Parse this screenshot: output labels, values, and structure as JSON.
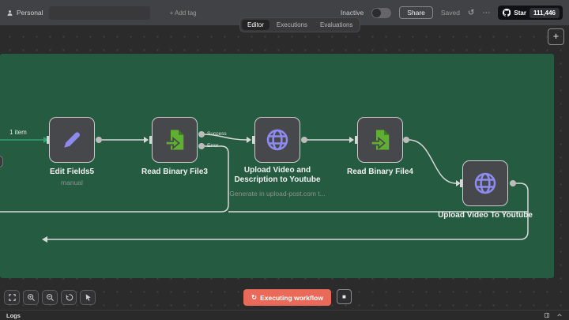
{
  "header": {
    "owner": "Personal",
    "workflow_name": "",
    "add_tag_label": "+ Add tag",
    "status_label": "Inactive",
    "share_label": "Share",
    "saved_label": "Saved",
    "github": {
      "star_label": "Star",
      "star_count": "111,446"
    }
  },
  "tabs": [
    {
      "label": "Editor",
      "active": true
    },
    {
      "label": "Executions",
      "active": false
    },
    {
      "label": "Evaluations",
      "active": false
    }
  ],
  "canvas": {
    "run_label": "1 item",
    "nodes": [
      {
        "name": "Edit Fields5",
        "subtitle": "manual",
        "icon": "pencil-icon"
      },
      {
        "name": "Read Binary File3",
        "subtitle": "",
        "icon": "file-import-icon",
        "outputs": [
          "Success",
          "Error"
        ]
      },
      {
        "name": "Upload Video and Description to Youtube",
        "subtitle": "Generate in upload-post.com t...",
        "icon": "globe-icon"
      },
      {
        "name": "Read Binary File4",
        "subtitle": "",
        "icon": "file-import-icon"
      },
      {
        "name": "Upload Video To Youtube",
        "subtitle": "",
        "icon": "globe-icon"
      }
    ]
  },
  "footer": {
    "executing_label": "Executing workflow",
    "logs_label": "Logs"
  },
  "icons": {
    "plus": "+",
    "more": "⋯",
    "history": "↺",
    "spinner": "↻",
    "stop": "■"
  },
  "colors": {
    "sticky_green": "#245b41",
    "node_purple": "#8f8af0",
    "node_green": "#5faf32",
    "edge_green": "#2fa572",
    "executing_orange": "#e96a58"
  }
}
